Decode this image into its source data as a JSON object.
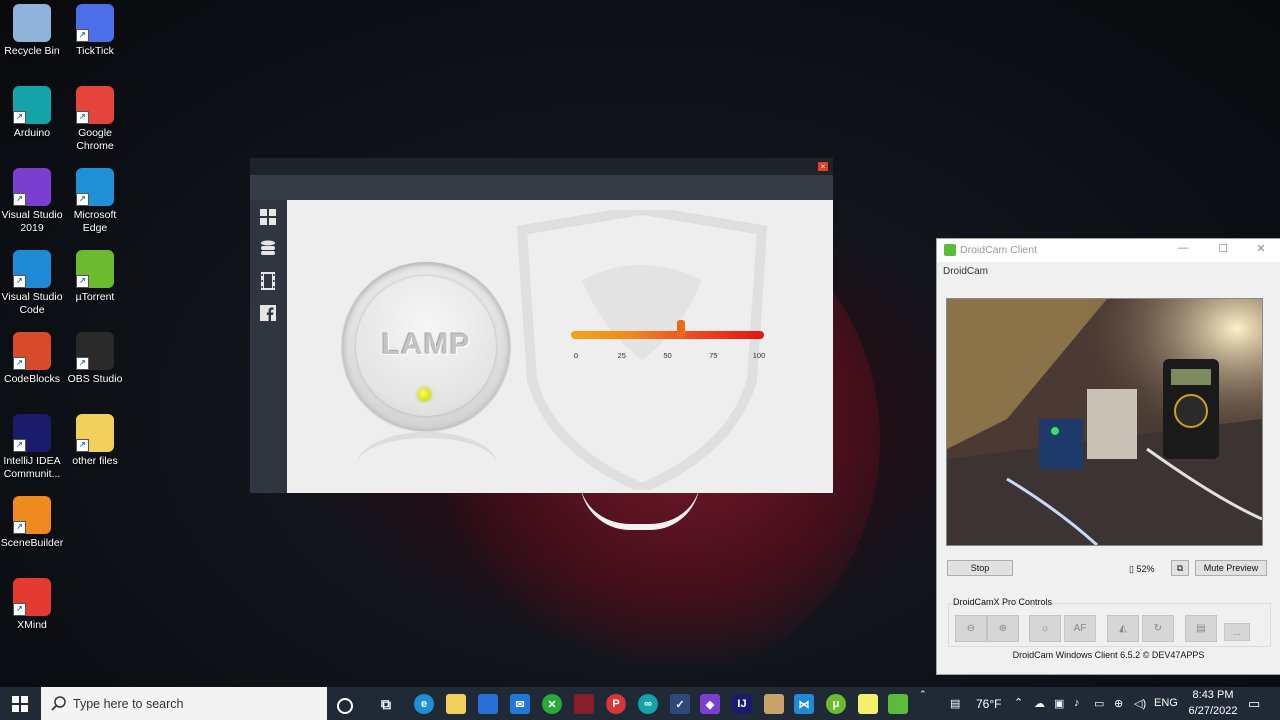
{
  "desktop": {
    "icons": [
      {
        "label": "Recycle Bin",
        "icon": "recycle-bin-icon",
        "color": "#8fb3d9"
      },
      {
        "label": "TickTick",
        "icon": "ticktick-icon",
        "color": "#4a6fe8"
      },
      {
        "label": "Arduino",
        "icon": "arduino-icon",
        "color": "#14a3a8"
      },
      {
        "label": "Google Chrome",
        "icon": "chrome-icon",
        "color": "#e5443b"
      },
      {
        "label": "Visual Studio 2019",
        "icon": "visual-studio-icon",
        "color": "#7a3fd1"
      },
      {
        "label": "Microsoft Edge",
        "icon": "edge-icon",
        "color": "#1f8fd6"
      },
      {
        "label": "Visual Studio Code",
        "icon": "vscode-icon",
        "color": "#1e8ad6"
      },
      {
        "label": "µTorrent",
        "icon": "utorrent-icon",
        "color": "#6cbb2e"
      },
      {
        "label": "CodeBlocks",
        "icon": "codeblocks-icon",
        "color": "#d94a2a"
      },
      {
        "label": "OBS Studio",
        "icon": "obs-icon",
        "color": "#2a2a2a"
      },
      {
        "label": "IntelliJ IDEA Communit...",
        "icon": "intellij-icon",
        "color": "#1b1b6b"
      },
      {
        "label": "other files",
        "icon": "folder-icon",
        "color": "#f2cf5b"
      },
      {
        "label": "SceneBuilder",
        "icon": "scenebuilder-icon",
        "color": "#f08a1e"
      },
      {
        "label": "XMind",
        "icon": "xmind-icon",
        "color": "#e43a32"
      }
    ]
  },
  "lamp_app": {
    "close_glyph": "×",
    "lamp_label": "LAMP",
    "slider": {
      "value_fraction": 0.57,
      "ticks": [
        "0",
        "25",
        "50",
        "75",
        "100"
      ]
    },
    "sidebar": [
      "dashboard-icon",
      "database-icon",
      "film-icon",
      "facebook-icon"
    ]
  },
  "droidcam": {
    "title": "DroidCam Client",
    "menu": "DroidCam",
    "stop_label": "Stop",
    "battery": "52%",
    "mute_label": "Mute Preview",
    "pro_label": "DroidCamX Pro Controls",
    "af_label": "AF",
    "more_label": "...",
    "footer": "DroidCam Windows Client 6.5.2 © DEV47APPS"
  },
  "taskbar": {
    "search_placeholder": "Type here to search",
    "weather": "76°F",
    "language": "ENG",
    "time": "8:43 PM",
    "date": "6/27/2022"
  }
}
